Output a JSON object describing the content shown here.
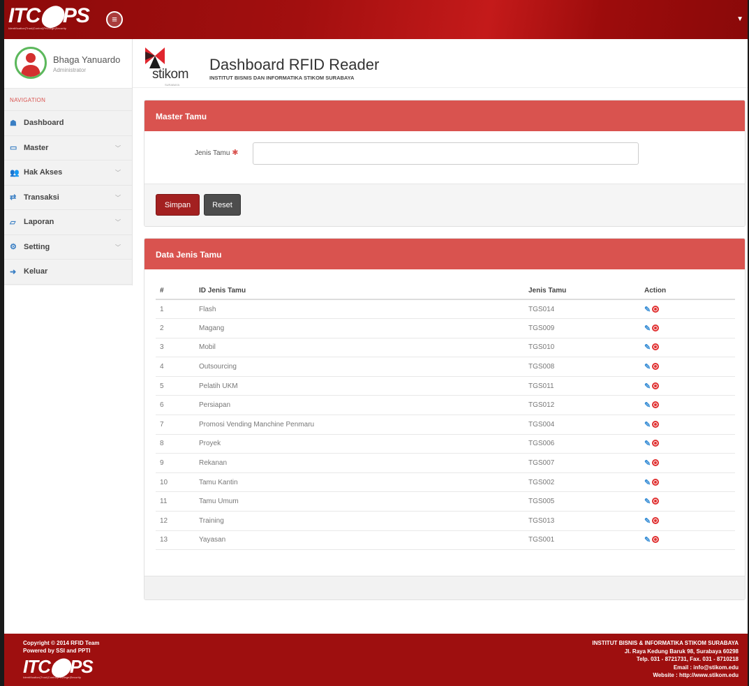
{
  "topbar": {
    "logo_text": "ITC⬤PS",
    "logo_tagline": "Identification|Trust|Control|Privilege|Security"
  },
  "user": {
    "name": "Bhaga Yanuardo",
    "role": "Administrator"
  },
  "nav": {
    "header": "NAVIGATION",
    "items": [
      {
        "label": "Dashboard",
        "icon": "dashboard-icon",
        "chevron": false
      },
      {
        "label": "Master",
        "icon": "laptop-icon",
        "chevron": true
      },
      {
        "label": "Hak Akses",
        "icon": "users-icon",
        "chevron": true
      },
      {
        "label": "Transaksi",
        "icon": "exchange-icon",
        "chevron": true
      },
      {
        "label": "Laporan",
        "icon": "folder-open-icon",
        "chevron": true
      },
      {
        "label": "Setting",
        "icon": "gear-icon",
        "chevron": true
      },
      {
        "label": "Keluar",
        "icon": "sign-out-icon",
        "chevron": false
      }
    ]
  },
  "brand": {
    "stikom_word": "stikom",
    "stikom_sub": "SURABAYA",
    "title": "Dashboard RFID Reader",
    "subtitle": "INSTITUT BISNIS DAN INFORMATIKA STIKOM SURABAYA"
  },
  "master_panel": {
    "title": "Master Tamu",
    "field_label": "Jenis Tamu",
    "required_mark": "✱",
    "field_value": "",
    "save_label": "Simpan",
    "reset_label": "Reset"
  },
  "data_panel": {
    "title": "Data Jenis Tamu",
    "columns": [
      "#",
      "ID Jenis Tamu",
      "Jenis Tamu",
      "Action"
    ],
    "rows": [
      [
        "1",
        "Flash",
        "TGS014"
      ],
      [
        "2",
        "Magang",
        "TGS009"
      ],
      [
        "3",
        "Mobil",
        "TGS010"
      ],
      [
        "4",
        "Outsourcing",
        "TGS008"
      ],
      [
        "5",
        "Pelatih UKM",
        "TGS011"
      ],
      [
        "6",
        "Persiapan",
        "TGS012"
      ],
      [
        "7",
        "Promosi Vending Manchine Penmaru",
        "TGS004"
      ],
      [
        "8",
        "Proyek",
        "TGS006"
      ],
      [
        "9",
        "Rekanan",
        "TGS007"
      ],
      [
        "10",
        "Tamu Kantin",
        "TGS002"
      ],
      [
        "11",
        "Tamu Umum",
        "TGS005"
      ],
      [
        "12",
        "Training",
        "TGS013"
      ],
      [
        "13",
        "Yayasan",
        "TGS001"
      ]
    ]
  },
  "footer": {
    "copyright": "Copyright © 2014 RFID Team",
    "powered": "Powered by SSI and PPTI",
    "inst_name": "INSTITUT BISNIS & INFORMATIKA STIKOM SURABAYA",
    "address": "Jl. Raya Kedung Baruk 98, Surabaya 60298",
    "phone": "Telp. 031 - 8721731, Fax. 031 - 8710218",
    "email": "Email : info@stikom.edu",
    "website": "Website : http://www.stikom.edu"
  },
  "colors": {
    "brand_red": "#9e0f0f",
    "panel_red": "#d9534f",
    "button_save": "#a32020",
    "button_reset": "#4d4d4d"
  }
}
